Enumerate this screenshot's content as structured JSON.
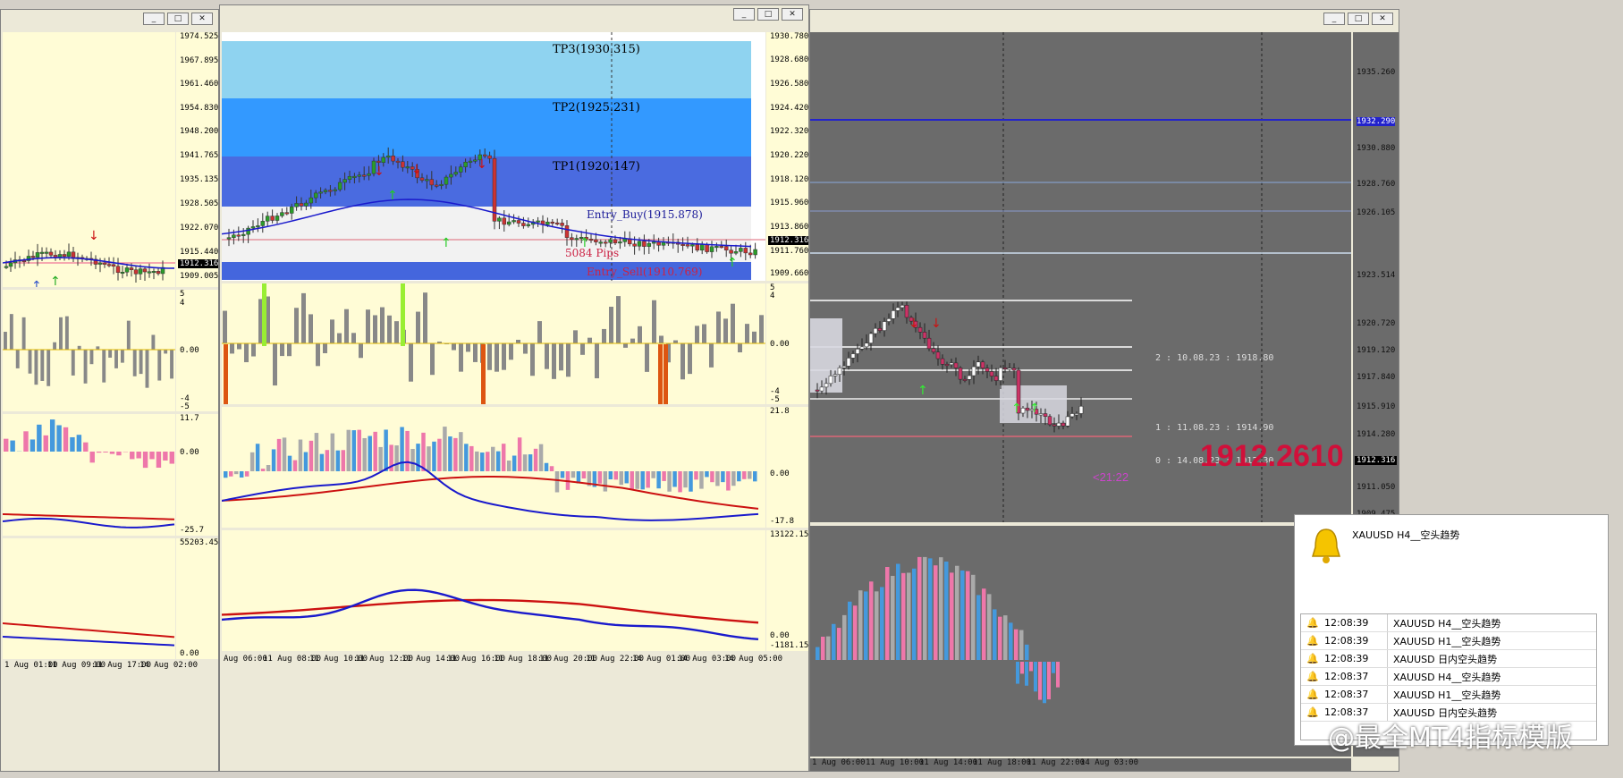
{
  "left_window": {
    "buttons": [
      "_",
      "□",
      "✕"
    ],
    "price_axis": [
      "1974.525",
      "1967.895",
      "1961.460",
      "1954.830",
      "1948.200",
      "1941.765",
      "1935.135",
      "1928.505",
      "1922.070",
      "1915.440",
      "1909.005"
    ],
    "current_price": "1912.316",
    "ind1_axis": [
      "5",
      "4",
      "0.00",
      "-4",
      "-5"
    ],
    "ind2_axis": [
      "11.7",
      "0.00",
      "-25.7"
    ],
    "ind3_axis": [
      "55203.45",
      "0.00"
    ],
    "time_axis": [
      "1 Aug 01:00",
      "11 Aug 09:00",
      "11 Aug 17:00",
      "14 Aug 02:00"
    ]
  },
  "middle_window": {
    "buttons": [
      "_",
      "□",
      "✕"
    ],
    "tp_labels": [
      "TP3(1930.315)",
      "TP2(1925.231)",
      "TP1(1920.147)"
    ],
    "entry_buy": "Entry_Buy(1915.878)",
    "entry_sell": "Entry_Sell(1910.769)",
    "pips_label": "5084 Pips",
    "price_axis": [
      "1930.780",
      "1928.680",
      "1926.580",
      "1924.420",
      "1922.320",
      "1920.220",
      "1918.120",
      "1915.960",
      "1913.860",
      "1911.760",
      "1909.660"
    ],
    "current_price": "1912.316",
    "ind1_axis": [
      "5",
      "4",
      "0.00",
      "-4",
      "-5"
    ],
    "ind2_axis": [
      "21.8",
      "0.00",
      "-17.8"
    ],
    "ind3_axis": [
      "13122.15",
      "0.00",
      "-1181.15"
    ],
    "time_axis": [
      "Aug 06:00",
      "11 Aug 08:00",
      "11 Aug 10:00",
      "11 Aug 12:00",
      "11 Aug 14:00",
      "11 Aug 16:00",
      "11 Aug 18:00",
      "11 Aug 20:00",
      "11 Aug 22:00",
      "14 Aug 01:00",
      "14 Aug 03:00",
      "14 Aug 05:00"
    ]
  },
  "right_window": {
    "buttons": [
      "_",
      "□",
      "✕"
    ],
    "price_axis": [
      "1935.260",
      "1932.290",
      "1930.880",
      "1928.760",
      "1926.105",
      "1923.514",
      "1920.720",
      "1919.120",
      "1917.840",
      "1915.910",
      "1914.280",
      "1912.316",
      "1911.050",
      "1909.475"
    ],
    "big_price": "1912.2610",
    "countdown": "<21:22",
    "levels": [
      "2 : 10.08.23 : 1918.80",
      "1 : 11.08.23 : 1914.90",
      "0 : 14.08.23 : 1912.30"
    ],
    "time_axis": [
      "1 Aug 06:00",
      "11 Aug 10:00",
      "11 Aug 14:00",
      "11 Aug 18:00",
      "11 Aug 22:00",
      "14 Aug 03:00"
    ]
  },
  "alert_popup": {
    "header_text": "XAUUSD  H4__空头趋势",
    "rows": [
      {
        "time": "12:08:39",
        "msg": "XAUUSD  H4__空头趋势"
      },
      {
        "time": "12:08:39",
        "msg": "XAUUSD  H1__空头趋势"
      },
      {
        "time": "12:08:39",
        "msg": "XAUUSD  日内空头趋势"
      },
      {
        "time": "12:08:37",
        "msg": "XAUUSD  H4__空头趋势"
      },
      {
        "time": "12:08:37",
        "msg": "XAUUSD  H1__空头趋势"
      },
      {
        "time": "12:08:37",
        "msg": "XAUUSD  日内空头趋势"
      }
    ]
  },
  "watermark_text": "@最全MT4指标模版",
  "colors": {
    "chart_bg": "#fffcd6",
    "dark_bg": "#6b6b6b",
    "blue_line": "#1a1acc",
    "red_line": "#cc1111",
    "tp_light": "#8fd3f0",
    "tp_mid": "#3399ff",
    "tp_dark": "#4466dd",
    "big_price": "#d0103a"
  }
}
